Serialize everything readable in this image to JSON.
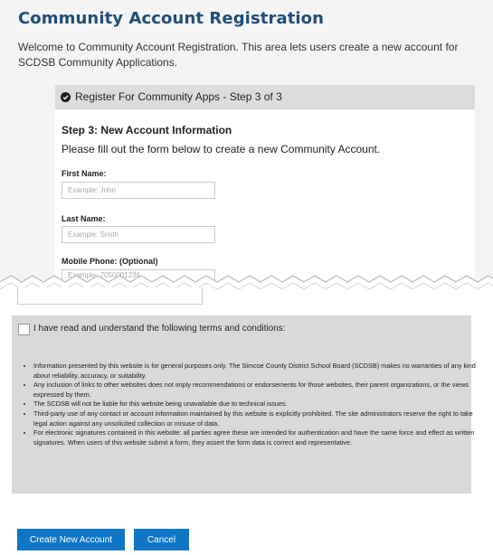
{
  "page": {
    "title": "Community Account Registration",
    "welcome": "Welcome to Community Account Registration. This area lets users create a new account for SCDSB Community Applications."
  },
  "step": {
    "header": "Register For Community Apps - Step 3 of 3",
    "subtitle": "Step 3: New Account Information",
    "instructions": "Please fill out the form below to create a new Community Account."
  },
  "form": {
    "first_name": {
      "label": "First Name:",
      "value": "",
      "placeholder": "Example: John"
    },
    "last_name": {
      "label": "Last Name:",
      "value": "",
      "placeholder": "Example: Smith"
    },
    "mobile_phone": {
      "label": "Mobile Phone: (Optional)",
      "value": "",
      "placeholder": "Example: 7050001234"
    }
  },
  "terms": {
    "checked": false,
    "intro": "I have read and understand the following terms and conditions:",
    "items": [
      "Information presented by this website is for general purposes only. The Simcoe County District School Board (SCDSB) makes no warranties of any kind about reliability, accuracy, or suitability.",
      "Any inclusion of links to other websites does not imply recommendations or endorsements for those websites, their parent organizations, or the views expressed by them.",
      "The SCDSB will not be liable for this website being unavailable due to technical issues.",
      "Third-party use of any contact or account information maintained by this website is explicitly prohibited. The site administrators reserve the right to take legal action against any unsolicited collection or misuse of data.",
      "For electronic signatures contained in this website: all parties agree these are intended for authentication and have the same force and effect as written signatures. When users of this website submit a form, they assert the form data is correct and representative."
    ]
  },
  "buttons": {
    "create": "Create New Account",
    "cancel": "Cancel"
  },
  "icons": {
    "step_header": "check-circle-icon"
  },
  "colors": {
    "title": "#1f4e79",
    "button": "#0f76c6",
    "panel_header": "#dcdcdc",
    "terms_background": "#d9d9d9"
  }
}
